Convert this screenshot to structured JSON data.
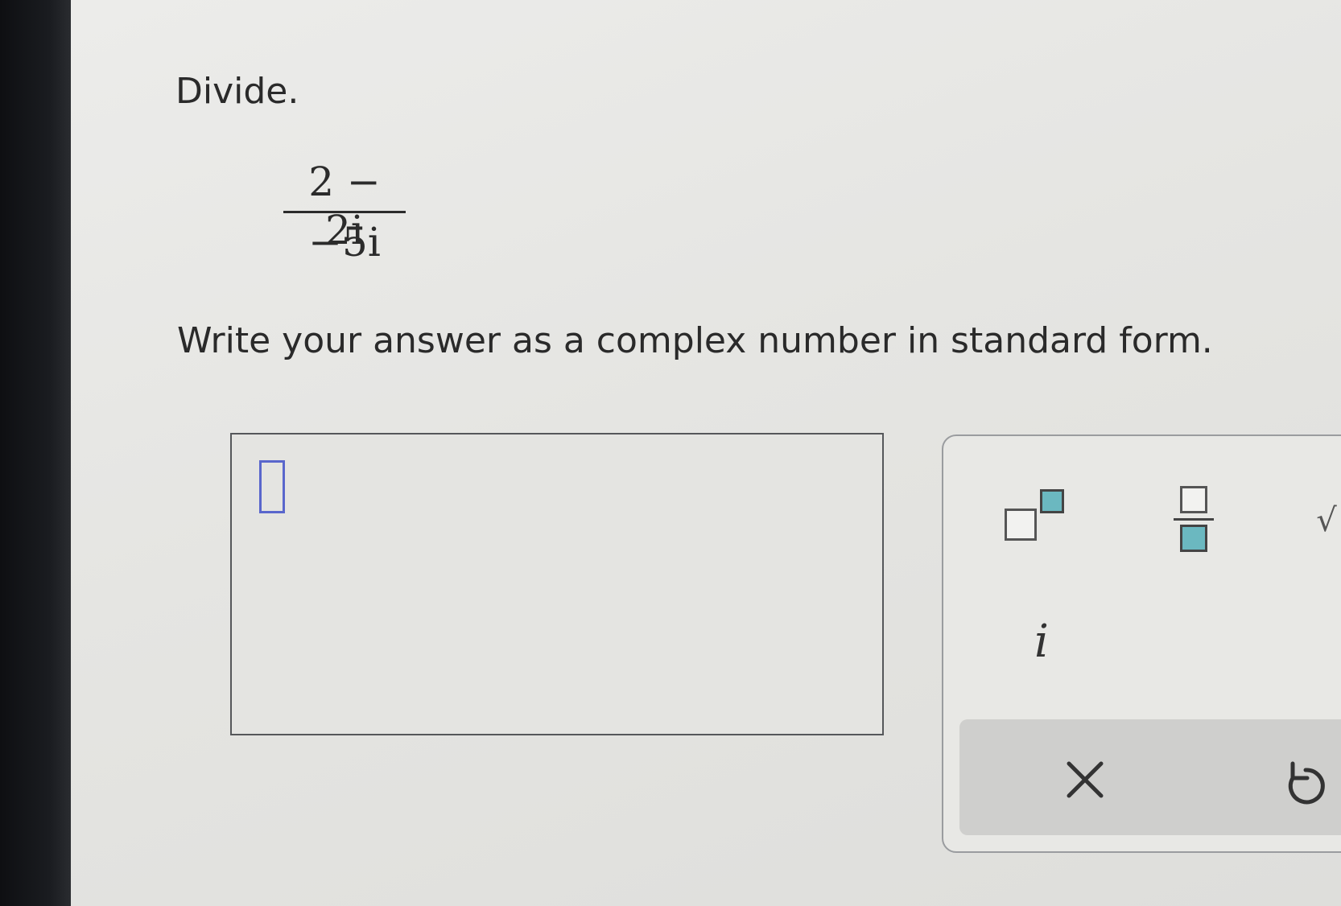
{
  "prompt": {
    "title": "Divide.",
    "fraction": {
      "numerator": "2 − 2i",
      "denominator": "−5i"
    },
    "instruction": "Write your answer as a complex number in standard form."
  },
  "answer": {
    "value": ""
  },
  "keypad": {
    "keys": [
      {
        "name": "superscript-key",
        "icon": "superscript-icon"
      },
      {
        "name": "fraction-key",
        "icon": "fraction-icon"
      },
      {
        "name": "square-root-key",
        "icon": "square-root-icon"
      },
      {
        "name": "imaginary-unit-key",
        "label": "i"
      }
    ],
    "actions": [
      {
        "name": "clear-button",
        "icon": "close-icon"
      },
      {
        "name": "undo-button",
        "icon": "undo-icon"
      }
    ],
    "colors": {
      "placeholder_fill": "#6bb8c0",
      "cursor_border": "#5966cc"
    }
  }
}
